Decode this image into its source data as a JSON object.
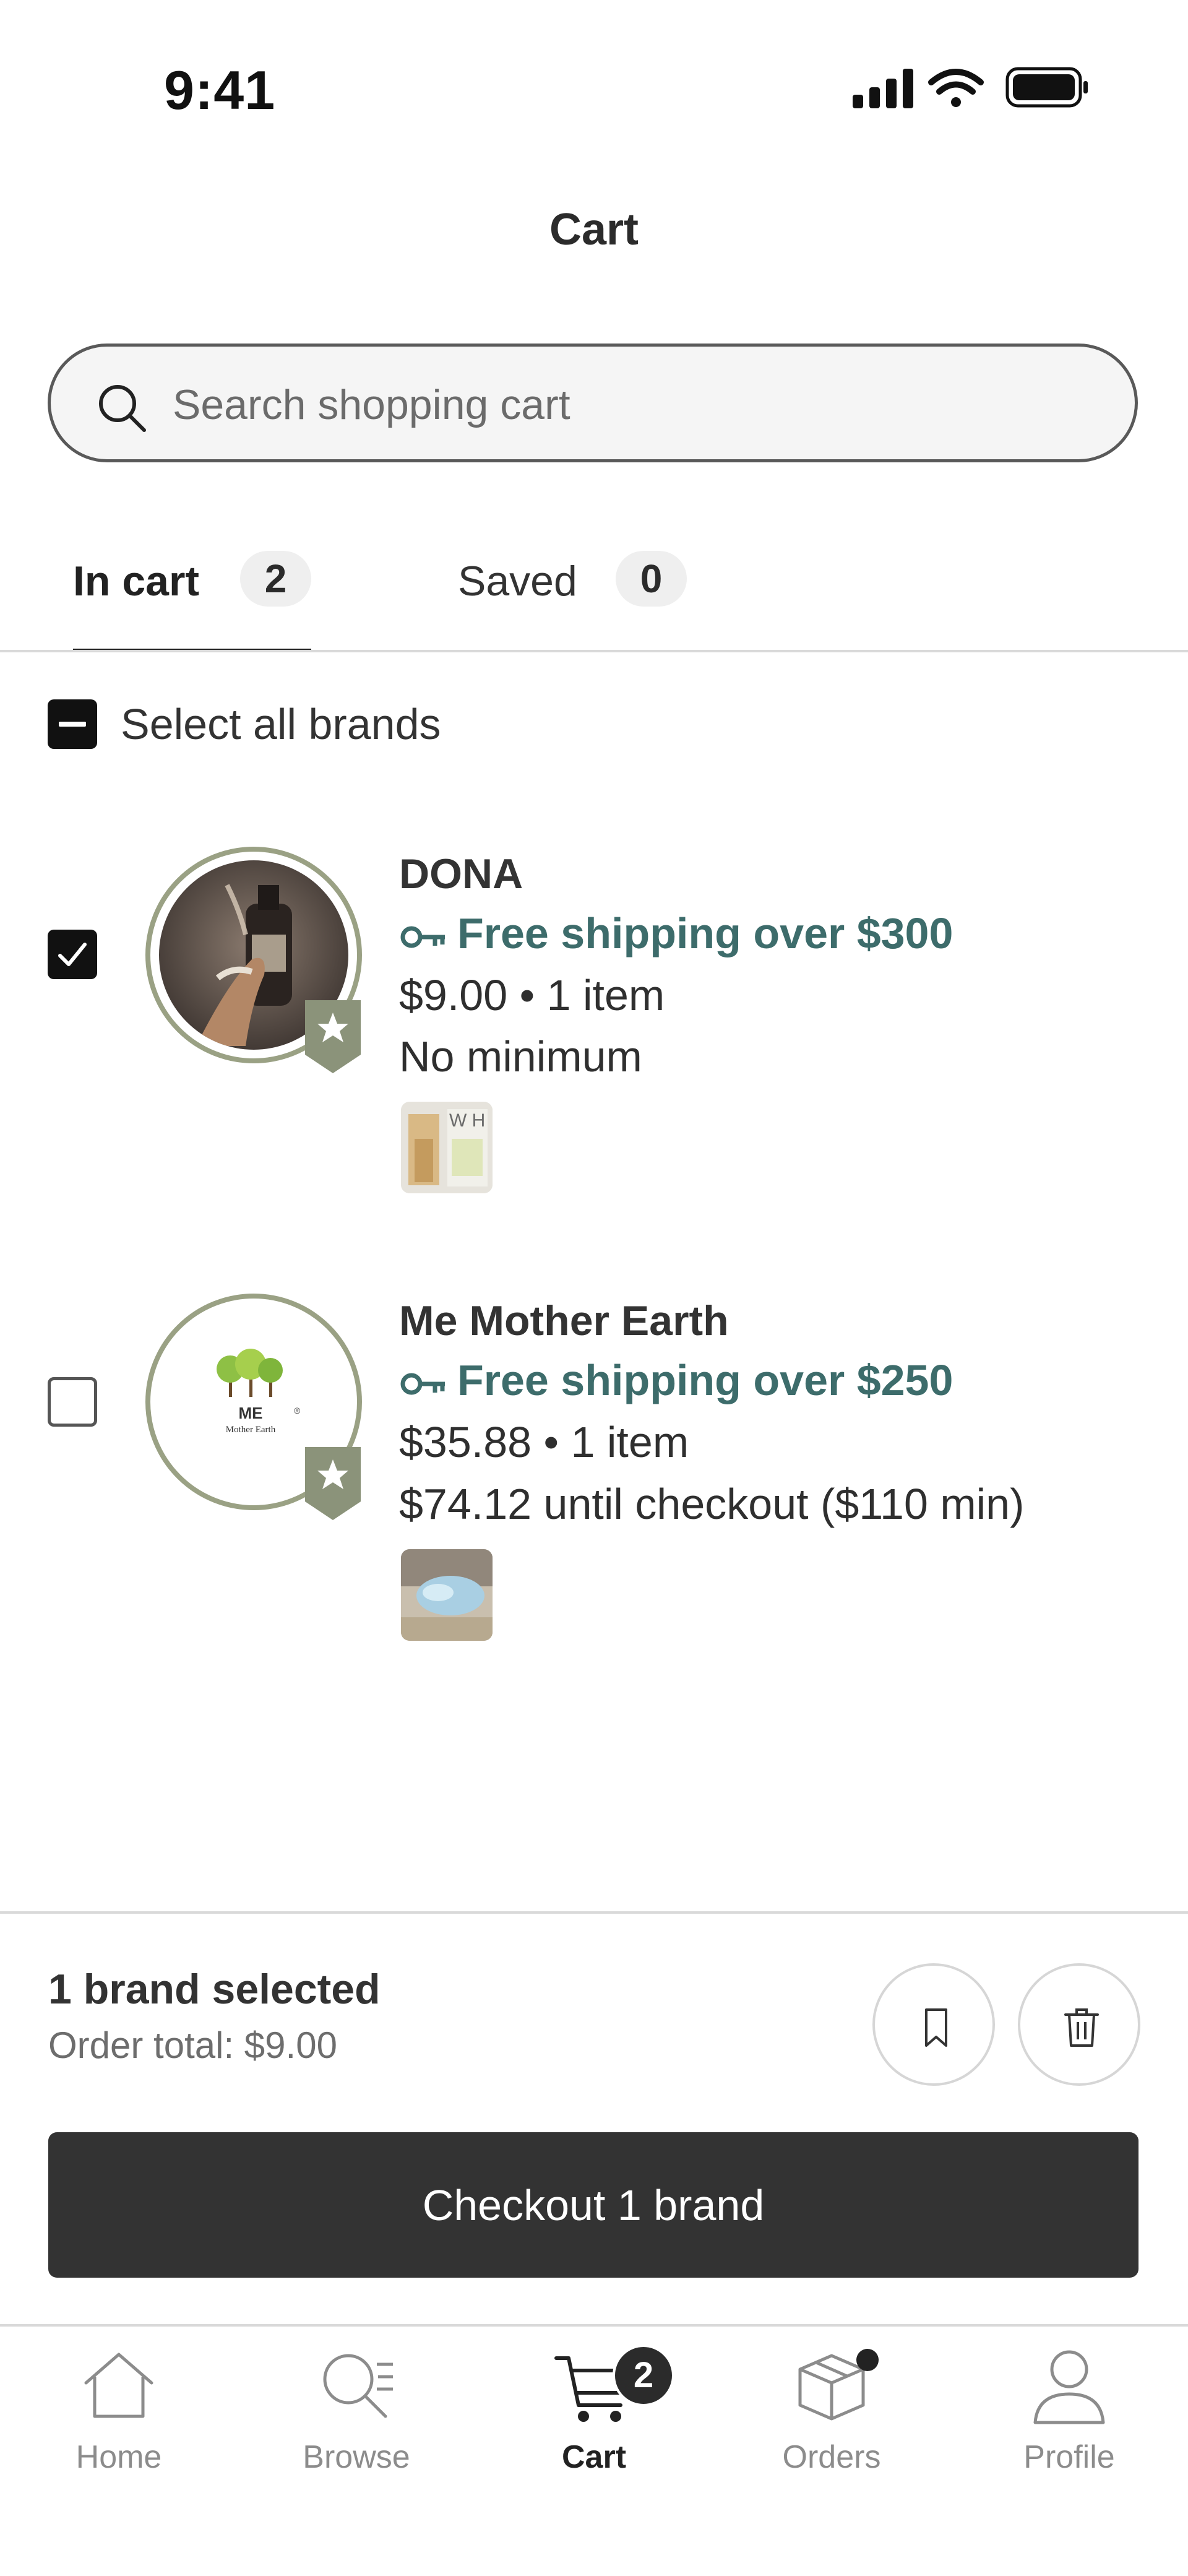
{
  "status_bar": {
    "time": "9:41",
    "icons": [
      "cellular-signal-icon",
      "wifi-icon",
      "battery-icon"
    ]
  },
  "header": {
    "title": "Cart"
  },
  "search": {
    "placeholder": "Search shopping cart"
  },
  "tabs": [
    {
      "label": "In cart",
      "count": "2",
      "active": true
    },
    {
      "label": "Saved",
      "count": "0",
      "active": false
    }
  ],
  "select_all": {
    "label": "Select all brands",
    "state": "indeterminate"
  },
  "brands": [
    {
      "name": "DONA",
      "shipping": "Free shipping over $300",
      "price_items": "$9.00 • 1 item",
      "minimum": "No minimum",
      "selected": true
    },
    {
      "name": "Me Mother Earth",
      "shipping": "Free shipping over $250",
      "price_items": "$35.88 • 1 item",
      "minimum": "$74.12 until checkout ($110 min)",
      "selected": false,
      "logo_text": {
        "line1": "ME",
        "line2": "Mother Earth"
      }
    }
  ],
  "summary": {
    "selected_count": "1 brand selected",
    "order_total": "Order total: $9.00",
    "checkout_label": "Checkout 1 brand"
  },
  "bottom_nav": [
    {
      "label": "Home",
      "icon": "home-icon"
    },
    {
      "label": "Browse",
      "icon": "browse-icon"
    },
    {
      "label": "Cart",
      "icon": "cart-icon",
      "badge": "2",
      "active": true
    },
    {
      "label": "Orders",
      "icon": "box-icon"
    },
    {
      "label": "Profile",
      "icon": "profile-icon"
    }
  ],
  "colors": {
    "accent_teal": "#3d6c6b",
    "avatar_ring": "#9aa184",
    "checkout_bg": "#333333"
  }
}
